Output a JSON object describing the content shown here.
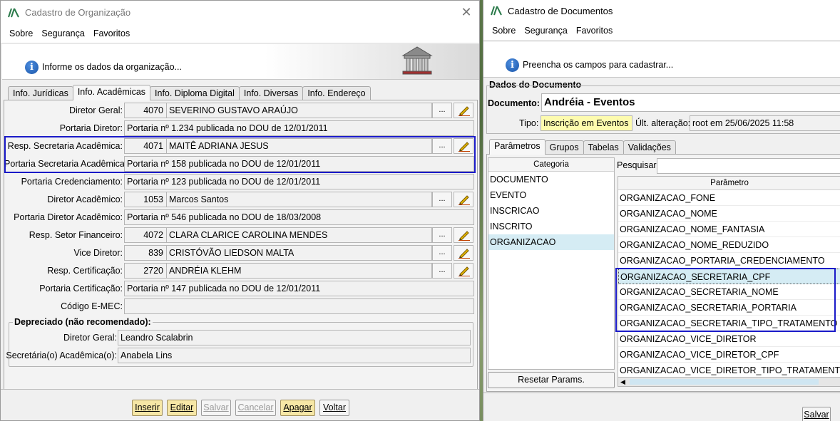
{
  "org_window": {
    "title": "Cadastro de Organização",
    "menu": [
      "Sobre",
      "Segurança",
      "Favoritos"
    ],
    "banner_text": "Informe os dados da organização...",
    "tabs": [
      "Info. Jurídicas",
      "Info. Acadêmicas",
      "Info. Diploma Digital",
      "Info. Diversas",
      "Info. Endereço"
    ],
    "active_tab": "Info. Acadêmicas",
    "fields": {
      "diretor_geral": {
        "label": "Diretor Geral:",
        "code": "4070",
        "name": "SEVERINO GUSTAVO ARAÚJO"
      },
      "portaria_diretor": {
        "label": "Portaria Diretor:",
        "value": "Portaria nº 1.234 publicada no DOU de 12/01/2011"
      },
      "resp_secretaria": {
        "label": "Resp. Secretaria Acadêmica:",
        "code": "4071",
        "name": "MAITÊ ADRIANA JESUS"
      },
      "portaria_secretaria": {
        "label": "Portaria Secretaria Acadêmica:",
        "value": "Portaria nº 158 publicada no DOU de 12/01/2011"
      },
      "portaria_credenciamento": {
        "label": "Portaria Credenciamento:",
        "value": "Portaria nº 123 publicada no DOU de 12/01/2011"
      },
      "diretor_academico": {
        "label": "Diretor Acadêmico:",
        "code": "1053",
        "name": "Marcos Santos"
      },
      "portaria_diretor_academico": {
        "label": "Portaria Diretor Acadêmico:",
        "value": "Portaria nº 546 publicada no DOU de 18/03/2008"
      },
      "resp_setor_financeiro": {
        "label": "Resp. Setor Financeiro:",
        "code": "4072",
        "name": "CLARA CLARICE CAROLINA MENDES"
      },
      "vice_diretor": {
        "label": "Vice Diretor:",
        "code": "839",
        "name": "CRISTÓVÃO LIEDSON MALTA"
      },
      "resp_certificacao": {
        "label": "Resp. Certificação:",
        "code": "2720",
        "name": "ANDRÉIA KLEHM"
      },
      "portaria_certificacao": {
        "label": "Portaria Certificação:",
        "value": "Portaria nº 147 publicada no DOU de 12/01/2011"
      },
      "codigo_emec": {
        "label": "Código E-MEC:",
        "value": ""
      }
    },
    "deprecated": {
      "legend": "Depreciado (não recomendado):",
      "diretor_geral_label": "Diretor Geral:",
      "diretor_geral_value": "Leandro Scalabrin",
      "secretaria_label": "Secretária(o) Acadêmica(o):",
      "secretaria_value": "Anabela Lins"
    },
    "buttons": {
      "inserir": "Inserir",
      "editar": "Editar",
      "salvar": "Salvar",
      "cancelar": "Cancelar",
      "apagar": "Apagar",
      "voltar": "Voltar"
    },
    "ellipsis": "..."
  },
  "doc_window": {
    "title": "Cadastro de Documentos",
    "menu": [
      "Sobre",
      "Segurança",
      "Favoritos"
    ],
    "banner_text": "Preencha os campos para cadastrar...",
    "section_title": "Dados do Documento",
    "documento_label": "Documento:",
    "documento_value": "Andréia - Eventos",
    "tipo_label": "Tipo:",
    "tipo_value": "Inscrição em Eventos",
    "ult_alteracao_label": "Últ. alteração:",
    "ult_alteracao_value": "root em 25/06/2025 11:58",
    "tabs": [
      "Parâmetros",
      "Grupos",
      "Tabelas",
      "Validações"
    ],
    "active_tab": "Parâmetros",
    "categoria_header": "Categoria",
    "categorias": [
      "DOCUMENTO",
      "EVENTO",
      "INSCRICAO",
      "INSCRITO",
      "ORGANIZACAO"
    ],
    "selected_categoria": "ORGANIZACAO",
    "pesquisar_label": "Pesquisar:",
    "parametro_header": "Parâmetro",
    "parametros": [
      "ORGANIZACAO_FONE",
      "ORGANIZACAO_NOME",
      "ORGANIZACAO_NOME_FANTASIA",
      "ORGANIZACAO_NOME_REDUZIDO",
      "ORGANIZACAO_PORTARIA_CREDENCIAMENTO",
      "ORGANIZACAO_SECRETARIA_CPF",
      "ORGANIZACAO_SECRETARIA_NOME",
      "ORGANIZACAO_SECRETARIA_PORTARIA",
      "ORGANIZACAO_SECRETARIA_TIPO_TRATAMENTO",
      "ORGANIZACAO_VICE_DIRETOR",
      "ORGANIZACAO_VICE_DIRETOR_CPF",
      "ORGANIZACAO_VICE_DIRETOR_TIPO_TRATAMENTO"
    ],
    "selected_parametro": "ORGANIZACAO_SECRETARIA_CPF",
    "resetar_label": "Resetar Params.",
    "salvar_label": "Salvar"
  },
  "colors": {
    "highlight": "#1a1ac8",
    "selection": "#d5ecf4",
    "tipo_bg": "#fdfbae",
    "button_yellow": "#f6e7a6"
  }
}
